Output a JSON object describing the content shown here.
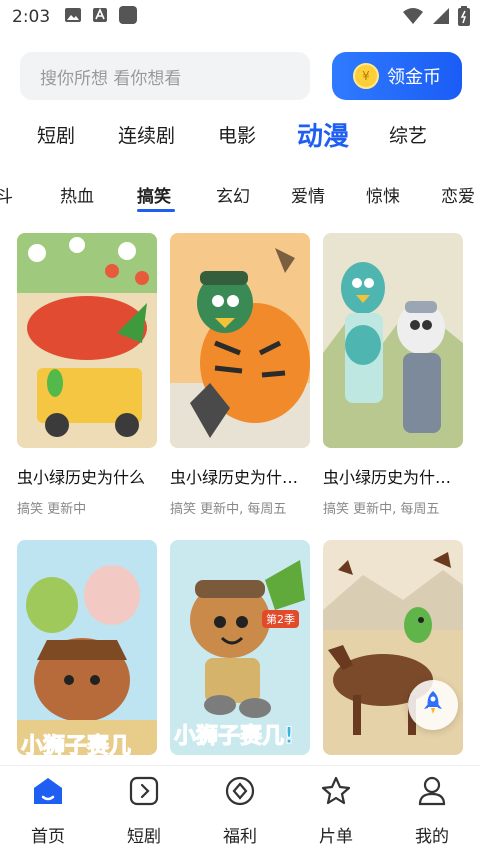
{
  "status_bar": {
    "time": "2:03"
  },
  "search": {
    "placeholder": "搜你所想 看你想看"
  },
  "coin_button": {
    "label": "领金币",
    "coin_symbol": "¥"
  },
  "categories": [
    "短剧",
    "连续剧",
    "电影",
    "动漫",
    "综艺"
  ],
  "active_category": "动漫",
  "sub_tabs": [
    "斗",
    "热血",
    "搞笑",
    "玄幻",
    "爱情",
    "惊悚",
    "恋爱"
  ],
  "active_sub_tab": "搞笑",
  "cards": [
    {
      "title": "虫小绿历史为什么",
      "meta": "搞笑  更新中"
    },
    {
      "title": "虫小绿历史为什…",
      "meta": "搞笑  更新中, 每周五"
    },
    {
      "title": "虫小绿历史为什…",
      "meta": "搞笑  更新中, 每周五"
    },
    {
      "title": "",
      "meta": "",
      "cover_text": "小狮子赛几"
    },
    {
      "title": "",
      "meta": "",
      "cover_text": "小狮子赛几!",
      "badge": "第2季"
    },
    {
      "title": "",
      "meta": ""
    }
  ],
  "bottom_nav": [
    {
      "label": "首页",
      "icon": "home-icon"
    },
    {
      "label": "短剧",
      "icon": "play-icon"
    },
    {
      "label": "福利",
      "icon": "gift-icon"
    },
    {
      "label": "片单",
      "icon": "star-icon"
    },
    {
      "label": "我的",
      "icon": "user-icon"
    }
  ],
  "colors": {
    "accent": "#1f5ef2",
    "coin_gradient_start": "#2f7bff",
    "coin": "#ffcf3a"
  }
}
